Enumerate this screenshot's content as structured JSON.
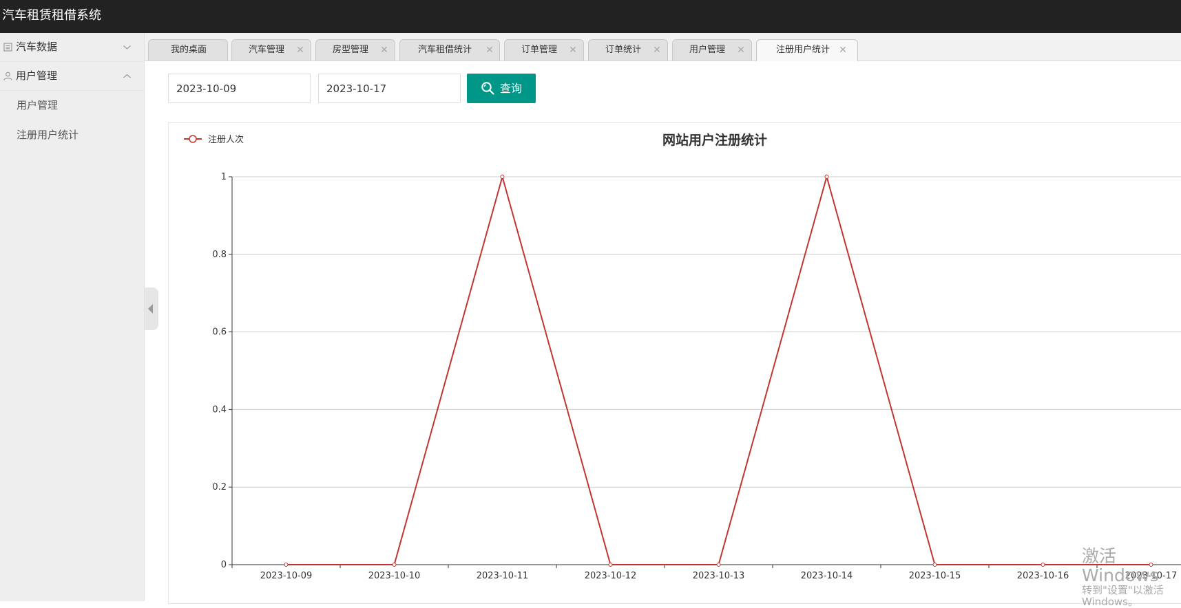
{
  "app": {
    "title": "汽车租赁租借系统"
  },
  "sidebar": {
    "groups": [
      {
        "label": "汽车数据",
        "icon": "list-icon",
        "expanded": false,
        "items": []
      },
      {
        "label": "用户管理",
        "icon": "user-icon",
        "expanded": true,
        "items": [
          {
            "label": "用户管理"
          },
          {
            "label": "注册用户统计"
          }
        ]
      }
    ]
  },
  "tabs": [
    {
      "label": "我的桌面",
      "closable": false,
      "active": false
    },
    {
      "label": "汽车管理",
      "closable": true,
      "active": false
    },
    {
      "label": "房型管理",
      "closable": true,
      "active": false
    },
    {
      "label": "汽车租借统计",
      "closable": true,
      "active": false
    },
    {
      "label": "订单管理",
      "closable": true,
      "active": false
    },
    {
      "label": "订单统计",
      "closable": true,
      "active": false
    },
    {
      "label": "用户管理",
      "closable": true,
      "active": false
    },
    {
      "label": "注册用户统计",
      "closable": true,
      "active": true
    }
  ],
  "filters": {
    "start_date": "2023-10-09",
    "end_date": "2023-10-17",
    "query_label": "查询",
    "query_icon": "search-icon",
    "accent_color": "#009688"
  },
  "chart_data": {
    "type": "line",
    "title": "网站用户注册统计",
    "categories": [
      "2023-10-09",
      "2023-10-10",
      "2023-10-11",
      "2023-10-12",
      "2023-10-13",
      "2023-10-14",
      "2023-10-15",
      "2023-10-16",
      "2023-10-17"
    ],
    "series": [
      {
        "name": "注册人次",
        "values": [
          0,
          0,
          1,
          0,
          0,
          1,
          0,
          0,
          0
        ],
        "color": "#c23531"
      }
    ],
    "ylim": [
      0,
      1
    ],
    "yticks": [
      "0",
      "0.2",
      "0.4",
      "0.6",
      "0.8",
      "1"
    ],
    "grid": true,
    "legend_position": "top-left"
  },
  "watermark": {
    "line1": "激活 Windows",
    "line2": "转到\"设置\"以激活 Windows。"
  }
}
